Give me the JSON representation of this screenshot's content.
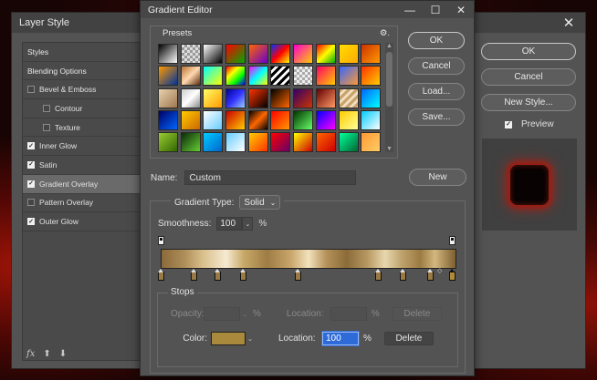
{
  "layer_style": {
    "title": "Layer Style",
    "close": "✕",
    "list": [
      {
        "label": "Styles",
        "kind": "header"
      },
      {
        "label": "Blending Options",
        "kind": "header"
      },
      {
        "label": "Bevel & Emboss",
        "checked": false
      },
      {
        "label": "Contour",
        "checked": false,
        "indent": true
      },
      {
        "label": "Texture",
        "checked": false,
        "indent": true
      },
      {
        "label": "Inner Glow",
        "checked": true
      },
      {
        "label": "Satin",
        "checked": true
      },
      {
        "label": "Gradient Overlay",
        "checked": true,
        "selected": true
      },
      {
        "label": "Pattern Overlay",
        "checked": false
      },
      {
        "label": "Outer Glow",
        "checked": true
      }
    ],
    "buttons": {
      "ok": "OK",
      "cancel": "Cancel",
      "new_style": "New Style..."
    },
    "preview_label": "Preview",
    "preview_checked": true,
    "bottom_icons": {
      "fx": "fx",
      "up": "⬆",
      "down": "⬇"
    }
  },
  "gradient_editor": {
    "title": "Gradient Editor",
    "window_controls": {
      "minimize": "—",
      "maximize": "☐",
      "close": "✕"
    },
    "presets_label": "Presets",
    "presets_gear": "⚙.",
    "buttons": {
      "ok": "OK",
      "cancel": "Cancel",
      "load": "Load...",
      "save": "Save...",
      "new": "New"
    },
    "name_label": "Name:",
    "name_value": "Custom",
    "gradient_type_label": "Gradient Type:",
    "gradient_type_value": "Solid",
    "smoothness_label": "Smoothness:",
    "smoothness_value": "100",
    "percent": "%",
    "stops": {
      "title": "Stops",
      "opacity_label": "Opacity:",
      "location_label": "Location:",
      "delete_label": "Delete",
      "color_label": "Color:",
      "color_value": "#a98a3c",
      "location_value": "100"
    },
    "presets": [
      "linear-gradient(135deg,#000,#fff)",
      "repeating-conic-gradient(#999 0 25%,#ddd 0 50%) 0 0/6px 6px",
      "linear-gradient(135deg,#fff,#000)",
      "linear-gradient(135deg,#ff0000,#00aa00)",
      "linear-gradient(135deg,#ff6600,#6600cc)",
      "linear-gradient(135deg,#0033ff,#ff0000,#ffff00)",
      "linear-gradient(135deg,#ff00cc,#ffcc00)",
      "linear-gradient(135deg,#ff0000,#ffff00,#00aa00)",
      "linear-gradient(135deg,#ffdd00,#ffaa00)",
      "linear-gradient(135deg,#cc3300,#ff9900)",
      "linear-gradient(135deg,#ff9900,#003399)",
      "linear-gradient(135deg,#b87333,#ffd8b0,#5a2d0c)",
      "linear-gradient(135deg,#00ffff,#ffff00)",
      "linear-gradient(135deg,#ff0000,#ffff00,#00ff00,#0000ff)",
      "linear-gradient(135deg,#ff00ff,#00ffff,#ffff00)",
      "repeating-linear-gradient(135deg,#000 0 3px,#fff 3px 6px)",
      "repeating-conic-gradient(#aaa 0 25%,#eee 0 50%) 0 0/6px 6px",
      "linear-gradient(135deg,#ff0066,#ffcc00)",
      "linear-gradient(135deg,#3366ff,#ff9933)",
      "linear-gradient(135deg,#ff3300,#ffcc00)",
      "linear-gradient(135deg,#e8d2b0,#a07850)",
      "linear-gradient(135deg,#cccccc,#ffffff,#888888)",
      "linear-gradient(135deg,#ffff66,#ff9900)",
      "linear-gradient(135deg,#000099,#3333ff,#99ccff)",
      "linear-gradient(135deg,#ff3300,#000000)",
      "linear-gradient(135deg,#000000,#ff6600)",
      "linear-gradient(135deg,#330066,#cc3300)",
      "linear-gradient(135deg,#660000,#ff9966)",
      "repeating-linear-gradient(135deg,#c9a36b 0 3px,#f0e0c0 3px 6px)",
      "linear-gradient(135deg,#0066ff,#00ffff)",
      "linear-gradient(135deg,#000066,#0066ff)",
      "linear-gradient(135deg,#ffcc00,#cc6600)",
      "linear-gradient(135deg,#ffffff,#66ccff)",
      "linear-gradient(135deg,#cc0000,#ffcc00)",
      "linear-gradient(135deg,#000,#ff6600,#000)",
      "linear-gradient(135deg,#ff0000,#ff9900)",
      "linear-gradient(135deg,#003300,#66ff66)",
      "linear-gradient(135deg,#0000ff,#ff00ff)",
      "linear-gradient(135deg,#ffcc00,#ffff99)",
      "linear-gradient(135deg,#00ccff,#ffffff)",
      "linear-gradient(135deg,#99cc33,#336600)",
      "linear-gradient(135deg,#0a2a0a,#66cc33)",
      "linear-gradient(135deg,#00ccff,#0066cc)",
      "linear-gradient(135deg,#66ccff,#ffffff)",
      "linear-gradient(135deg,#ffcc00,#ff3300)",
      "linear-gradient(135deg,#ff0000,#660066)",
      "linear-gradient(135deg,#ffff00,#cc0000)",
      "linear-gradient(135deg,#ff6600,#cc0000)",
      "linear-gradient(135deg,#00ff99,#006633)",
      "linear-gradient(135deg,#ff9933,#ffcc66)"
    ]
  }
}
